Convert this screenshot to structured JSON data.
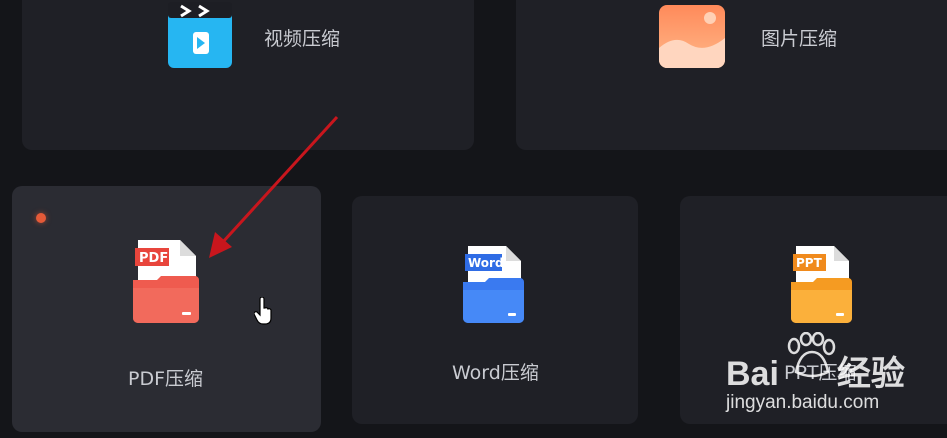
{
  "colors": {
    "background": "#141519",
    "card": "#1f2026",
    "card_hover": "#2b2c33",
    "pdf_accent": "#ef5b4f",
    "word_accent": "#3f82f5",
    "ppt_accent": "#f7a531",
    "annotation_arrow": "#c8161d"
  },
  "tools": {
    "video": {
      "label": "视频压缩",
      "icon": "video-file-icon"
    },
    "image": {
      "label": "图片压缩",
      "icon": "image-file-icon"
    },
    "pdf": {
      "label": "PDF压缩",
      "icon": "pdf-folder-icon",
      "badge": "PDF"
    },
    "word": {
      "label": "Word压缩",
      "icon": "word-folder-icon",
      "badge": "Word"
    },
    "ppt": {
      "label": "PPT压缩",
      "icon": "ppt-folder-icon",
      "badge": "PPT"
    }
  },
  "watermark": {
    "brand": "Bai",
    "brand_tail": "经验",
    "url": "jingyan.baidu.com"
  }
}
